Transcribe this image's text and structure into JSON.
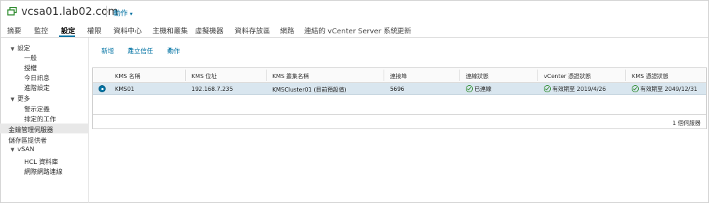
{
  "header": {
    "title": "vcsa01.lab02.com",
    "actions_label": "動作",
    "icon": "vm-group-icon",
    "accent_color": "#0072a3"
  },
  "tabs": [
    {
      "label": "摘要"
    },
    {
      "label": "監控"
    },
    {
      "label": "設定",
      "active": true
    },
    {
      "label": "權限"
    },
    {
      "label": "資料中心"
    },
    {
      "label": "主機和叢集"
    },
    {
      "label": "虛擬機器"
    },
    {
      "label": "資料存放區"
    },
    {
      "label": "網路"
    },
    {
      "label": "連結的 vCenter Server 系統"
    },
    {
      "label": "更新"
    }
  ],
  "sidebar": {
    "groups": [
      {
        "label": "設定",
        "items": [
          "一般",
          "授權",
          "今日訊息",
          "進階設定"
        ]
      },
      {
        "label": "更多",
        "items": [
          "警示定義",
          "排定的工作"
        ]
      },
      {
        "label": "金鑰管理伺服器",
        "selected": true
      },
      {
        "label": "儲存區提供者"
      },
      {
        "label": "vSAN",
        "items": [
          "HCL 資料庫",
          "網際網路連線"
        ]
      }
    ]
  },
  "toolbar": {
    "add_label": "新增",
    "trust_label": "建立信任",
    "actions_label": "動作"
  },
  "grid": {
    "columns": [
      "KMS 名稱",
      "KMS 位址",
      "KMS 叢集名稱",
      "連接埠",
      "連線狀態",
      "vCenter 憑證狀態",
      "KMS 憑證狀態"
    ],
    "rows": [
      {
        "name": "KMS01",
        "address": "192.168.7.235",
        "cluster": "KMSCluster01 (目前預設值)",
        "port": "5696",
        "connection": "已連線",
        "vc_cert": "有效期至 2019/4/26",
        "kms_cert": "有效期至 2049/12/31"
      }
    ],
    "footer": "1 個伺服器"
  }
}
